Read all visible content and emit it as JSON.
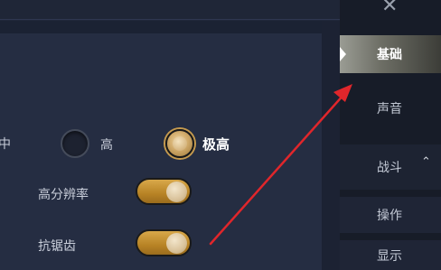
{
  "settings": {
    "quality_row_label": "中",
    "quality_options": [
      {
        "label": "高",
        "selected": false
      },
      {
        "label": "极高",
        "selected": true
      }
    ],
    "toggles": [
      {
        "label": "高分辨率",
        "on": true
      },
      {
        "label": "抗锯齿",
        "on": true
      }
    ]
  },
  "sidebar": {
    "close_icon": "close-icon",
    "items": [
      {
        "label": "基础",
        "active": true
      },
      {
        "label": "声音",
        "active": false
      },
      {
        "label": "战斗",
        "active": false,
        "expanded": true
      },
      {
        "label": "操作",
        "active": false
      },
      {
        "label": "显示",
        "active": false
      }
    ]
  },
  "annotation": {
    "arrow_color": "#e0262b"
  },
  "colors": {
    "accent": "#c59a4e",
    "panel": "#252d42",
    "sidebar": "#171c28"
  }
}
